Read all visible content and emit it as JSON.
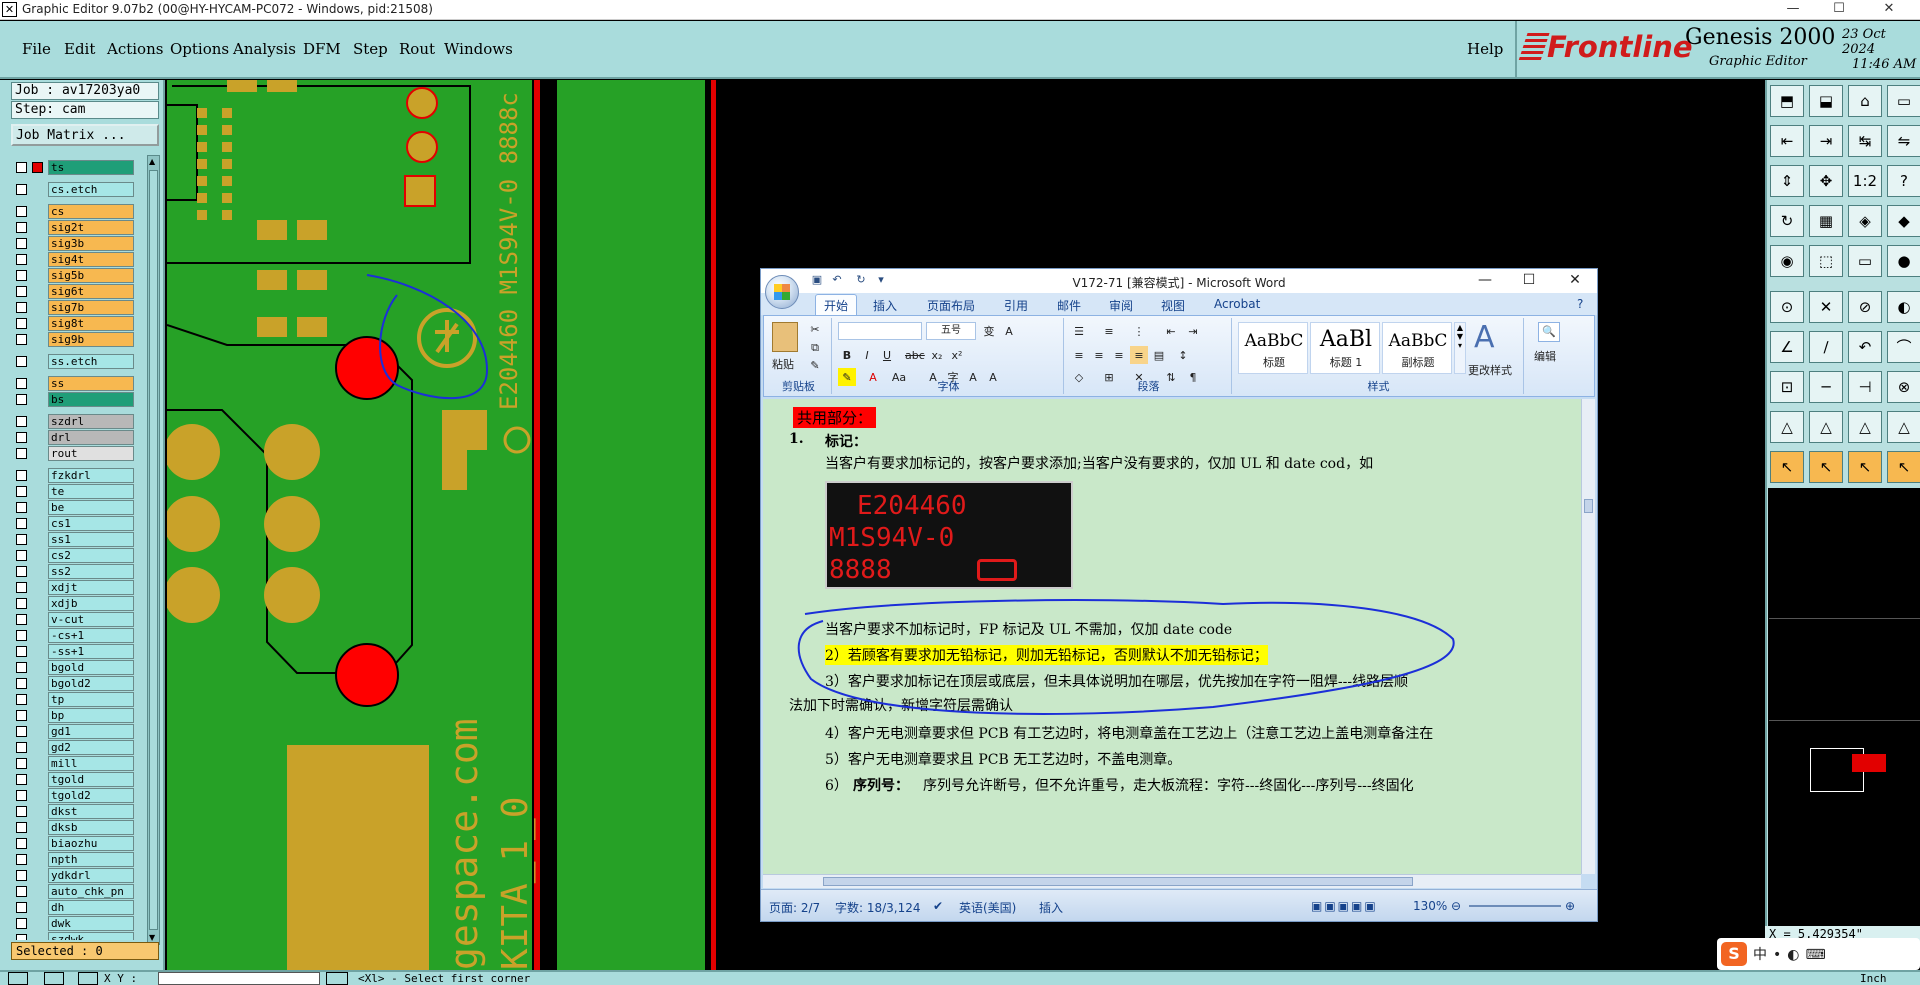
{
  "titlebar": {
    "title": "Graphic Editor 9.07b2 (00@HY-HYCAM-PC072 - Windows, pid:21508)",
    "minimize": "—",
    "maximize": "☐",
    "close": "✕"
  },
  "menu": {
    "items": [
      "File",
      "Edit",
      "Actions",
      "Options",
      "Analysis",
      "DFM",
      "Step",
      "Rout",
      "Windows"
    ],
    "help": "Help"
  },
  "brand": {
    "company": "Frontline",
    "product": "Genesis 2000",
    "subtitle": "Graphic Editor",
    "date": "23 Oct 2024",
    "time": "11:46 AM"
  },
  "left_panel": {
    "job": "Job : av17203ya0",
    "step": "Step: cam",
    "job_matrix": "Job Matrix ...",
    "selected": "Selected : 0",
    "layers": [
      {
        "name": "ts",
        "color": "#1f9e78",
        "gap": 0
      },
      {
        "name": "cs.etch",
        "color": "#a6e6e6",
        "gap": 6
      },
      {
        "name": "cs",
        "color": "#f7b850",
        "gap": 6
      },
      {
        "name": "sig2t",
        "color": "#f7b850",
        "gap": 0
      },
      {
        "name": "sig3b",
        "color": "#f7b850",
        "gap": 0
      },
      {
        "name": "sig4t",
        "color": "#f7b850",
        "gap": 0
      },
      {
        "name": "sig5b",
        "color": "#f7b850",
        "gap": 0
      },
      {
        "name": "sig6t",
        "color": "#f7b850",
        "gap": 0
      },
      {
        "name": "sig7b",
        "color": "#f7b850",
        "gap": 0
      },
      {
        "name": "sig8t",
        "color": "#f7b850",
        "gap": 0
      },
      {
        "name": "sig9b",
        "color": "#f7b850",
        "gap": 0
      },
      {
        "name": "ss.etch",
        "color": "#a6e6e6",
        "gap": 6
      },
      {
        "name": "ss",
        "color": "#f7b850",
        "gap": 6
      },
      {
        "name": "bs",
        "color": "#1f9e78",
        "gap": 0
      },
      {
        "name": "szdrl",
        "color": "#b8b8b8",
        "gap": 6
      },
      {
        "name": "drl",
        "color": "#b8b8b8",
        "gap": 0
      },
      {
        "name": "rout",
        "color": "#e0e0e0",
        "gap": 0
      },
      {
        "name": "fzkdrl",
        "color": "#a6e6e6",
        "gap": 6
      },
      {
        "name": "te",
        "color": "#a6e6e6",
        "gap": 0
      },
      {
        "name": "be",
        "color": "#a6e6e6",
        "gap": 0
      },
      {
        "name": "cs1",
        "color": "#a6e6e6",
        "gap": 0
      },
      {
        "name": "ss1",
        "color": "#a6e6e6",
        "gap": 0
      },
      {
        "name": "cs2",
        "color": "#a6e6e6",
        "gap": 0
      },
      {
        "name": "ss2",
        "color": "#a6e6e6",
        "gap": 0
      },
      {
        "name": "xdjt",
        "color": "#a6e6e6",
        "gap": 0
      },
      {
        "name": "xdjb",
        "color": "#a6e6e6",
        "gap": 0
      },
      {
        "name": "v-cut",
        "color": "#a6e6e6",
        "gap": 0
      },
      {
        "name": "-cs+1",
        "color": "#a6e6e6",
        "gap": 0
      },
      {
        "name": "-ss+1",
        "color": "#a6e6e6",
        "gap": 0
      },
      {
        "name": "bgold",
        "color": "#a6e6e6",
        "gap": 0
      },
      {
        "name": "bgold2",
        "color": "#a6e6e6",
        "gap": 0
      },
      {
        "name": "tp",
        "color": "#a6e6e6",
        "gap": 0
      },
      {
        "name": "bp",
        "color": "#a6e6e6",
        "gap": 0
      },
      {
        "name": "gd1",
        "color": "#a6e6e6",
        "gap": 0
      },
      {
        "name": "gd2",
        "color": "#a6e6e6",
        "gap": 0
      },
      {
        "name": "mill",
        "color": "#a6e6e6",
        "gap": 0
      },
      {
        "name": "tgold",
        "color": "#a6e6e6",
        "gap": 0
      },
      {
        "name": "tgold2",
        "color": "#a6e6e6",
        "gap": 0
      },
      {
        "name": "dkst",
        "color": "#a6e6e6",
        "gap": 0
      },
      {
        "name": "dksb",
        "color": "#a6e6e6",
        "gap": 0
      },
      {
        "name": "biaozhu",
        "color": "#a6e6e6",
        "gap": 0
      },
      {
        "name": "npth",
        "color": "#a6e6e6",
        "gap": 0
      },
      {
        "name": "ydkdrl",
        "color": "#a6e6e6",
        "gap": 0
      },
      {
        "name": "auto_chk_pn",
        "color": "#a6e6e6",
        "gap": 0
      },
      {
        "name": "dh",
        "color": "#a6e6e6",
        "gap": 0
      },
      {
        "name": "dwk",
        "color": "#a6e6e6",
        "gap": 0
      },
      {
        "name": "szdwk",
        "color": "#a6e6e6",
        "gap": 0
      }
    ]
  },
  "canvas": {
    "pcb_text_1": "E204460 M1S94V-0 8888c",
    "pcb_text_2": "gespace.com",
    "pcb_text_3": "KITA_1_0"
  },
  "word": {
    "title": "V172-71 [兼容模式] - Microsoft Word",
    "tabs": [
      "开始",
      "插入",
      "页面布局",
      "引用",
      "邮件",
      "审阅",
      "视图",
      "Acrobat"
    ],
    "clipboard": {
      "paste": "粘贴",
      "label": "剪贴板"
    },
    "font": {
      "size": "五号",
      "label": "字体"
    },
    "paragraph": {
      "label": "段落"
    },
    "styles": {
      "label": "样式",
      "items": [
        {
          "preview": "AaBbC",
          "name": "标题"
        },
        {
          "preview": "AaBl",
          "name": "标题 1"
        },
        {
          "preview": "AaBbC",
          "name": "副标题"
        }
      ],
      "change": "更改样式"
    },
    "editing": {
      "label": "编辑"
    },
    "doc": {
      "heading": "共用部分：",
      "item1_num": "1.",
      "item1_title": "标记：",
      "line1": "当客户有要求加标记的，按客户要求添加;当客户没有要求的，仅加 UL 和 date cod，如",
      "image_lines": [
        "E204460",
        "M1S94V-0",
        "8888"
      ],
      "line2": "当客户要求不加标记时，FP 标记及 UL 不需加，仅加 date code",
      "line3": "2）若顾客有要求加无铅标记，则加无铅标记，否则默认不加无铅标记；",
      "line4": "3）客户要求加标记在顶层或底层，但未具体说明加在哪层，优先按加在字符一阻焊---线路层顺",
      "line5": "法加下时需确认，新增字符层需确认",
      "line6": "4）客户无电测章要求但 PCB 有工艺边时，将电测章盖在工艺边上（注意工艺边上盖电测章备注在",
      "line7": "5）客户无电测章要求且 PCB 无工艺边时，不盖电测章。",
      "line8_num": "6）",
      "line8_title": "序列号：",
      "line8": "序列号允许断号，但不允许重号，走大板流程：字符---终固化---序列号---终固化"
    },
    "status": {
      "page": "页面: 2/7",
      "words": "字数: 18/3,124",
      "lang": "英语(美国)",
      "mode": "插入",
      "zoom": "130%"
    }
  },
  "right_panel": {
    "coord_x": "X = 5.429354\""
  },
  "statusbar": {
    "xy": "X Y :",
    "prompt": "<Xl> - Select first corner",
    "units": "Inch"
  }
}
